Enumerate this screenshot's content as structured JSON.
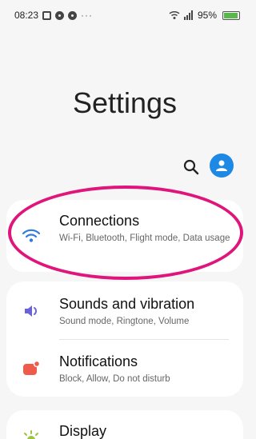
{
  "status_bar": {
    "time": "08:23",
    "more": "···",
    "battery": "95%",
    "battery_level": 0.95,
    "icons": [
      "gallery-icon",
      "notification-dot-icon",
      "notification-dot-icon",
      "wifi-icon",
      "signal-icon",
      "battery-icon"
    ]
  },
  "header": {
    "title": "Settings",
    "search_icon": "search-icon",
    "avatar_icon": "account-icon"
  },
  "settings": {
    "connections": {
      "title": "Connections",
      "subtitle": "Wi-Fi, Bluetooth, Flight mode, Data usage",
      "icon": "wifi-icon",
      "icon_color": "#2f7de1"
    },
    "sounds": {
      "title": "Sounds and vibration",
      "subtitle": "Sound mode, Ringtone, Volume",
      "icon": "speaker-icon",
      "icon_color": "#6a62d9"
    },
    "notifications": {
      "title": "Notifications",
      "subtitle": "Block, Allow, Do not disturb",
      "icon": "notification-icon",
      "icon_color": "#ef5b4a"
    },
    "display": {
      "title": "Display",
      "icon": "brightness-icon",
      "icon_color": "#9bc53d"
    }
  },
  "annotation": {
    "highlight_color": "#e0157b"
  }
}
